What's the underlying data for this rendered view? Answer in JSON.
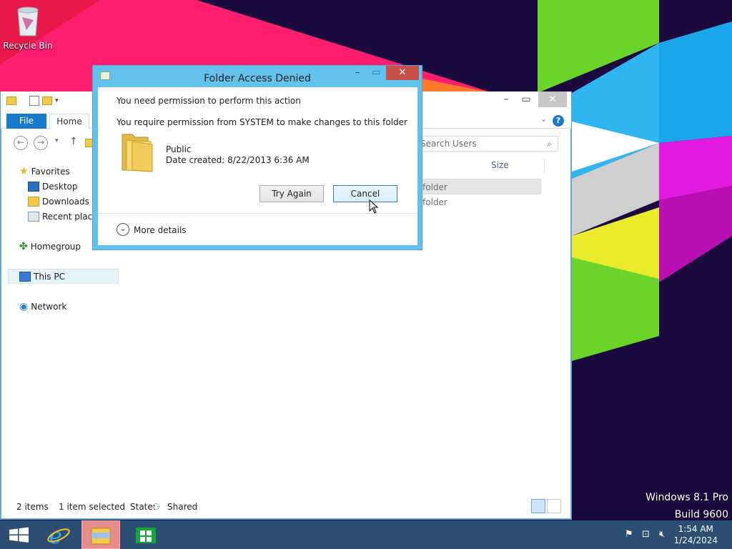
{
  "desktop": {
    "recycle_bin_label": "Recycle Bin",
    "watermark_line1": "Windows 8.1 Pro",
    "watermark_line2": "Build 9600"
  },
  "explorer": {
    "tabs": {
      "file": "File",
      "home": "Home"
    },
    "search_placeholder": "Search Users",
    "nav": {
      "favorites": "Favorites",
      "desktop": "Desktop",
      "downloads": "Downloads",
      "recent": "Recent places",
      "homegroup": "Homegroup",
      "this_pc": "This PC",
      "network": "Network"
    },
    "columns": {
      "size": "Size"
    },
    "rows": [
      {
        "type": "folder"
      },
      {
        "type": "folder"
      }
    ],
    "status": {
      "items": "2 items",
      "selected": "1 item selected",
      "state_label": "State:",
      "state_value": "Shared"
    }
  },
  "dialog": {
    "title": "Folder Access Denied",
    "heading": "You need permission to perform this action",
    "message": "You require permission from SYSTEM to make changes to this folder",
    "item_name": "Public",
    "item_date": "Date created: 8/22/2013 6:36 AM",
    "try_again": "Try Again",
    "cancel": "Cancel",
    "more_details": "More details"
  },
  "taskbar": {
    "time": "1:54 AM",
    "date": "1/24/2024"
  },
  "colors": {
    "accent": "#1979ca",
    "dialog_frame": "#63c2ec",
    "close_button": "#c7504a",
    "taskbar": "#2c4e73"
  }
}
